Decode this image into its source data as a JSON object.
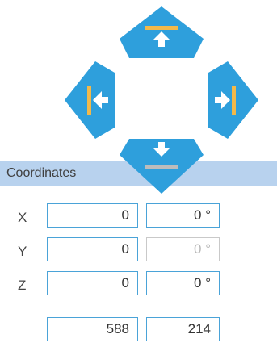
{
  "nav": {
    "up": {
      "icon": "move-to-top-icon"
    },
    "left": {
      "icon": "move-to-left-icon"
    },
    "right": {
      "icon": "move-to-right-icon"
    },
    "down": {
      "icon": "move-to-bottom-icon"
    },
    "colors": {
      "fill": "#2e9fdc",
      "accent": "#f2b94a",
      "arrow": "#ffffff"
    }
  },
  "coordinates": {
    "title": "Coordinates",
    "rows": [
      {
        "label": "X",
        "value": "0",
        "angle": "0 °",
        "angle_enabled": true
      },
      {
        "label": "Y",
        "value": "0",
        "angle": "0 °",
        "angle_enabled": false
      },
      {
        "label": "Z",
        "value": "0",
        "angle": "0 °",
        "angle_enabled": true
      }
    ],
    "extra": {
      "a": "588",
      "b": "214"
    }
  }
}
